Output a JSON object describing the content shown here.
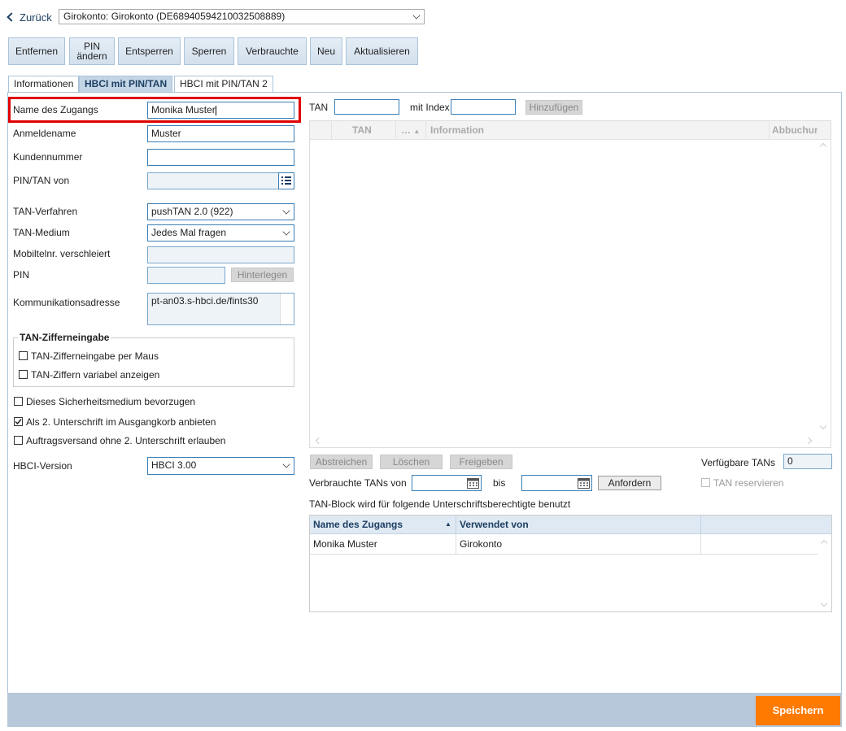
{
  "header": {
    "back_label": "Zurück",
    "account_select": "Girokonto: Girokonto (DE68940594210032508889)"
  },
  "toolbar": {
    "remove": "Entfernen",
    "pin_change_line1": "PIN",
    "pin_change_line2": "ändern",
    "unlock": "Entsperren",
    "lock": "Sperren",
    "used": "Verbrauchte",
    "new": "Neu",
    "refresh": "Aktualisieren"
  },
  "tabs": [
    "Informationen",
    "HBCI mit PIN/TAN",
    "HBCI mit PIN/TAN 2"
  ],
  "form": {
    "access_name_label": "Name des Zugangs",
    "access_name_value": "Monika Muster",
    "login_label": "Anmeldename",
    "login_value": "Muster",
    "customer_no_label": "Kundennummer",
    "customer_no_value": "",
    "pintan_from_label": "PIN/TAN von",
    "pintan_from_value": "",
    "tan_method_label": "TAN-Verfahren",
    "tan_method_value": "pushTAN 2.0 (922)",
    "tan_medium_label": "TAN-Medium",
    "tan_medium_value": "Jedes Mal fragen",
    "mobile_label": "Mobiltelnr. verschleiert",
    "mobile_value": "",
    "pin_label": "PIN",
    "pin_value": "",
    "store_button": "Hinterlegen",
    "address_label": "Kommunikationsadresse",
    "address_value": "pt-an03.s-hbci.de/fints30",
    "tan_digit_group_title": "TAN-Zifferneingabe",
    "tan_digit_mouse": "TAN-Zifferneingabe per Maus",
    "tan_digit_variable": "TAN-Ziffern variabel anzeigen",
    "prefer_medium": "Dieses Sicherheitsmedium bevorzugen",
    "second_signature": "Als 2. Unterschrift im Ausgangkorb anbieten",
    "allow_without_second": "Auftragsversand ohne 2. Unterschrift erlauben",
    "checks": {
      "prefer_medium": false,
      "second_signature": true,
      "allow_without_second": false,
      "tan_digit_mouse": false,
      "tan_digit_variable": false
    },
    "hbci_version_label": "HBCI-Version",
    "hbci_version_value": "HBCI 3.00"
  },
  "tan_panel": {
    "tan_label": "TAN",
    "index_label": "mit Index",
    "add_button": "Hinzufügen",
    "columns": [
      "TAN",
      "…",
      "Information",
      "Abbuchun"
    ],
    "strike_button": "Abstreichen",
    "delete_button": "Löschen",
    "release_button": "Freigeben",
    "available_label": "Verfügbare TANs",
    "available_value": "0",
    "used_from_label": "Verbrauchte TANs von",
    "used_to_label": "bis",
    "request_button": "Anfordern",
    "reserve_label": "TAN reservieren",
    "block_note": "TAN-Block wird für folgende Unterschriftsberechtigte benutzt",
    "users_columns": [
      "Name des Zugangs",
      "Verwendet von"
    ],
    "users_rows": [
      {
        "name": "Monika Muster",
        "used_by": "Girokonto"
      }
    ]
  },
  "footer": {
    "save_button": "Speichern"
  },
  "colors": {
    "accent_orange": "#ff7a00",
    "highlight_red": "#e00000",
    "footer_bar": "#b7c8db"
  }
}
